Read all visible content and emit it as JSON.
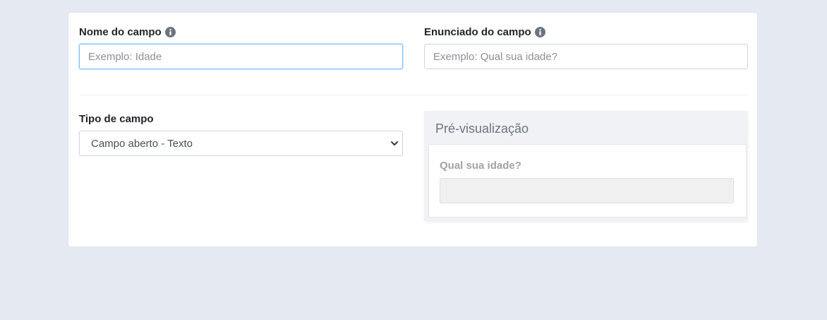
{
  "form": {
    "field_name": {
      "label": "Nome do campo",
      "placeholder": "Exemplo: Idade",
      "value": ""
    },
    "field_statement": {
      "label": "Enunciado do campo",
      "placeholder": "Exemplo: Qual sua idade?",
      "value": ""
    },
    "field_type": {
      "label": "Tipo de campo",
      "selected": "Campo aberto - Texto"
    }
  },
  "preview": {
    "title": "Pré-visualização",
    "question": "Qual sua idade?"
  },
  "colors": {
    "page_background": "#e5e9f2",
    "focus_border": "#80bdff",
    "icon": "#6c757d"
  },
  "icons": {
    "info": "info-icon",
    "select": "chevron-down-icon"
  }
}
